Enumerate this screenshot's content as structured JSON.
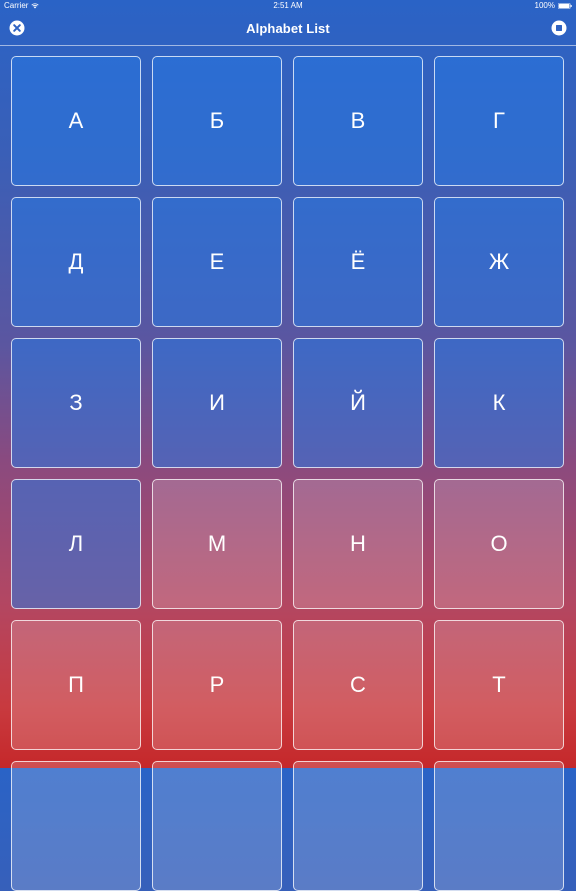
{
  "status_bar": {
    "carrier": "Carrier",
    "time": "2:51 AM",
    "battery": "100%"
  },
  "nav_bar": {
    "title": "Alphabet List",
    "left_icon": "close-icon",
    "right_icon": "stop-icon"
  },
  "colors": {
    "tile_blue": "#2878e1",
    "tile_border": "#ffffff"
  },
  "letters": [
    {
      "char": "А",
      "style": "blue"
    },
    {
      "char": "Б",
      "style": "blue"
    },
    {
      "char": "В",
      "style": "blue"
    },
    {
      "char": "Г",
      "style": "blue"
    },
    {
      "char": "Д",
      "style": "blue"
    },
    {
      "char": "Е",
      "style": "blue"
    },
    {
      "char": "Ё",
      "style": "blue"
    },
    {
      "char": "Ж",
      "style": "blue"
    },
    {
      "char": "З",
      "style": "blue"
    },
    {
      "char": "И",
      "style": "blue"
    },
    {
      "char": "Й",
      "style": "blue"
    },
    {
      "char": "К",
      "style": "blue"
    },
    {
      "char": "Л",
      "style": "blue"
    },
    {
      "char": "М",
      "style": "rose"
    },
    {
      "char": "Н",
      "style": "rose"
    },
    {
      "char": "О",
      "style": "rose"
    },
    {
      "char": "П",
      "style": "rose"
    },
    {
      "char": "Р",
      "style": "rose"
    },
    {
      "char": "С",
      "style": "rose"
    },
    {
      "char": "Т",
      "style": "rose"
    },
    {
      "char": "",
      "style": "rose"
    },
    {
      "char": "",
      "style": "rose"
    },
    {
      "char": "",
      "style": "rose"
    },
    {
      "char": "",
      "style": "rose"
    }
  ]
}
